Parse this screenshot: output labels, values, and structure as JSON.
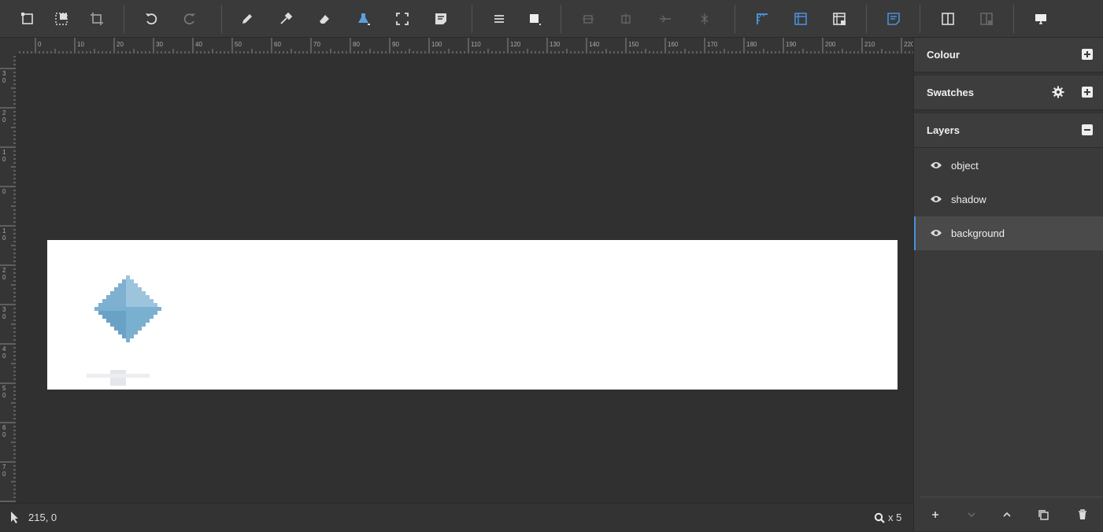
{
  "toolbar": {
    "tools": [
      {
        "name": "resize-canvas-icon"
      },
      {
        "name": "select-area-icon"
      },
      {
        "name": "crop-icon"
      },
      {
        "name": "undo-icon"
      },
      {
        "name": "redo-icon"
      },
      {
        "name": "pencil-icon"
      },
      {
        "name": "eyedropper-icon"
      },
      {
        "name": "eraser-icon"
      },
      {
        "name": "fill-bucket-icon"
      },
      {
        "name": "fullscreen-icon"
      },
      {
        "name": "notes-icon"
      },
      {
        "name": "menu-icon"
      },
      {
        "name": "brush-size-icon"
      },
      {
        "name": "flip-horizontal-icon"
      },
      {
        "name": "flip-vertical-icon"
      },
      {
        "name": "rotate-icon"
      },
      {
        "name": "mirror-icon"
      },
      {
        "name": "ruler-guide-icon"
      },
      {
        "name": "grid-icon"
      },
      {
        "name": "lock-grid-icon"
      },
      {
        "name": "annotation-icon"
      },
      {
        "name": "split-view-icon"
      },
      {
        "name": "split-lock-icon"
      },
      {
        "name": "monitor-icon"
      }
    ],
    "accent": "#4a90d9"
  },
  "ruler": {
    "top_labels": [
      "0",
      "10",
      "20",
      "30",
      "40",
      "50",
      "60",
      "70",
      "80",
      "90",
      "100",
      "110",
      "120",
      "130",
      "140",
      "150",
      "160",
      "170",
      "180",
      "190",
      "200",
      "210",
      "220"
    ],
    "left_labels": [
      "3 0",
      "2 0",
      "1 0",
      "0",
      "1 0",
      "2 0",
      "3 0",
      "4 0",
      "5 0",
      "6 0",
      "7 0"
    ]
  },
  "status": {
    "coords": "215, 0",
    "zoom": "x 5"
  },
  "panel": {
    "colour_title": "Colour",
    "swatches_title": "Swatches",
    "layers_title": "Layers",
    "layers": [
      {
        "label": "object",
        "active": false
      },
      {
        "label": "shadow",
        "active": false
      },
      {
        "label": "background",
        "active": true
      }
    ]
  }
}
